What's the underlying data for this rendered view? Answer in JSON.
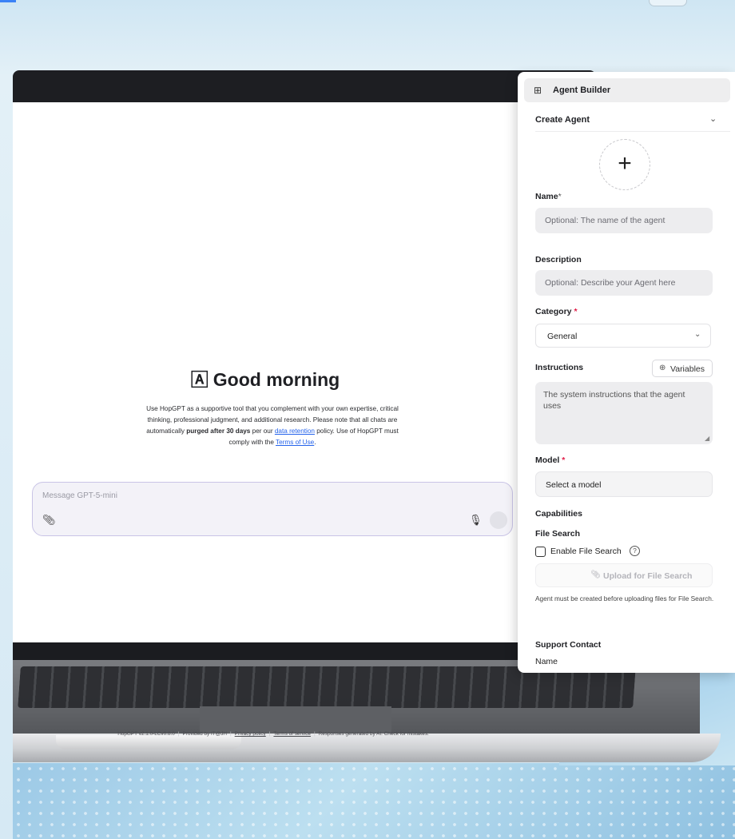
{
  "chat": {
    "greeting": "Good morning",
    "greeting_icon": "hopgpt-logo-icon",
    "intro": {
      "t1": "Use HopGPT as a supportive tool that you complement with your own expertise, critical thinking, professional judgment, and additional research. Please note that all chats are automatically ",
      "bold": "purged after 30 days",
      "t2": " per our ",
      "link1": "data retention",
      "t3": " policy. Use of HopGPT must comply with the ",
      "link2": "Terms of Use",
      "t4": "."
    },
    "placeholder": "Message GPT-5-mini",
    "footer": {
      "version": "HopGPT v2.1.0-LCv0.8.0",
      "provider": "Provided by IT@JH",
      "privacy": "Privacy policy",
      "terms": "Terms of service",
      "disclaimer": "Responses generated by AI. Check for mistakes."
    }
  },
  "panel": {
    "title": "Agent Builder",
    "section": "Create Agent",
    "name_label": "Name",
    "name_required": "*",
    "name_placeholder": "Optional: The name of the agent",
    "description_label": "Description",
    "description_placeholder": "Optional: Describe your Agent here",
    "category_label": "Category",
    "category_required": "*",
    "category_value": "General",
    "instructions_label": "Instructions",
    "variables_button": "Variables",
    "instructions_placeholder": "The system instructions that the agent uses",
    "model_label": "Model",
    "model_required": "*",
    "model_value": "Select a model",
    "capabilities_label": "Capabilities",
    "file_search_label": "File Search",
    "enable_file_search": "Enable File Search",
    "upload_button": "Upload for File Search",
    "upload_note": "Agent must be created before uploading files for File Search.",
    "support_contact": "Support Contact",
    "support_name": "Name"
  },
  "colors": {
    "accent": "#2563eb",
    "required": "#e11d48",
    "composer_border": "#c9c4e6"
  }
}
